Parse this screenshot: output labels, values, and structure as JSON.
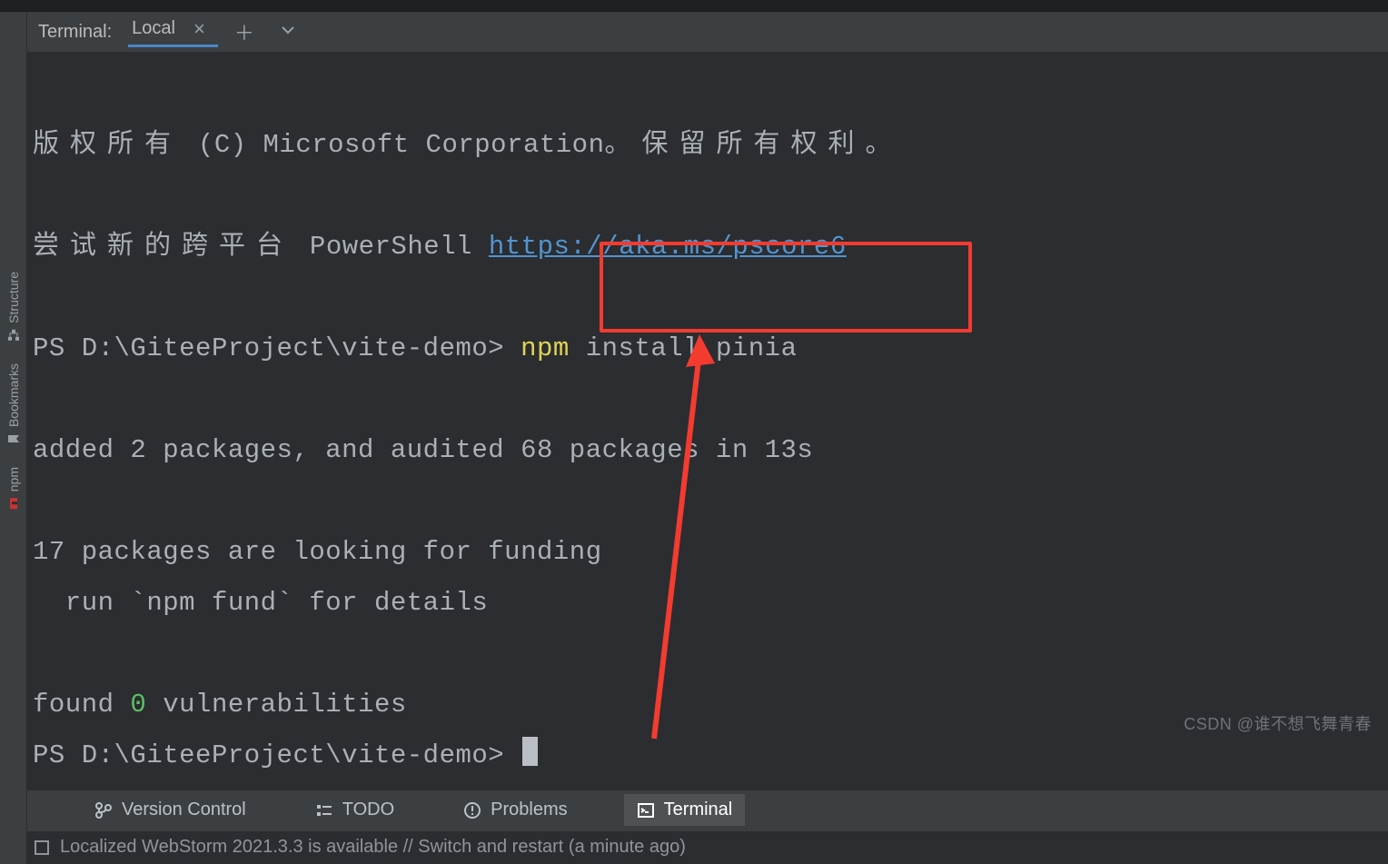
{
  "terminal_header": {
    "title": "Terminal:",
    "tab_label": "Local"
  },
  "console": {
    "copyright_cjk_pre": "版权所有",
    "copyright_en": "(C) Microsoft Corporation",
    "copyright_cjk_post_period": "。保留所有权利。",
    "try_cjk": "尝试新的跨平台",
    "try_en": "PowerShell",
    "pscore_link": "https://aka.ms/pscore6",
    "prompt1_ps": "PS ",
    "prompt1_path": "D:\\GiteeProject\\vite-demo>",
    "cmd_npm": "npm",
    "cmd_rest": " install pinia",
    "added_line": "added 2 packages, and audited 68 packages in 13s",
    "funding_line1": "17 packages are looking for funding",
    "funding_line2": "  run `npm fund` for details",
    "found_pre": "found ",
    "found_zero": "0",
    "found_post": " vulnerabilities",
    "prompt2_ps": "PS ",
    "prompt2_path": "D:\\GiteeProject\\vite-demo>"
  },
  "sidebar": {
    "structure": "Structure",
    "bookmarks": "Bookmarks",
    "npm": "npm"
  },
  "bottom_bar": {
    "vcs": "Version Control",
    "todo": "TODO",
    "problems": "Problems",
    "terminal": "Terminal"
  },
  "status_text": "Localized WebStorm 2021.3.3 is available // Switch and restart (a minute ago)",
  "watermark": "CSDN @谁不想飞舞青春"
}
